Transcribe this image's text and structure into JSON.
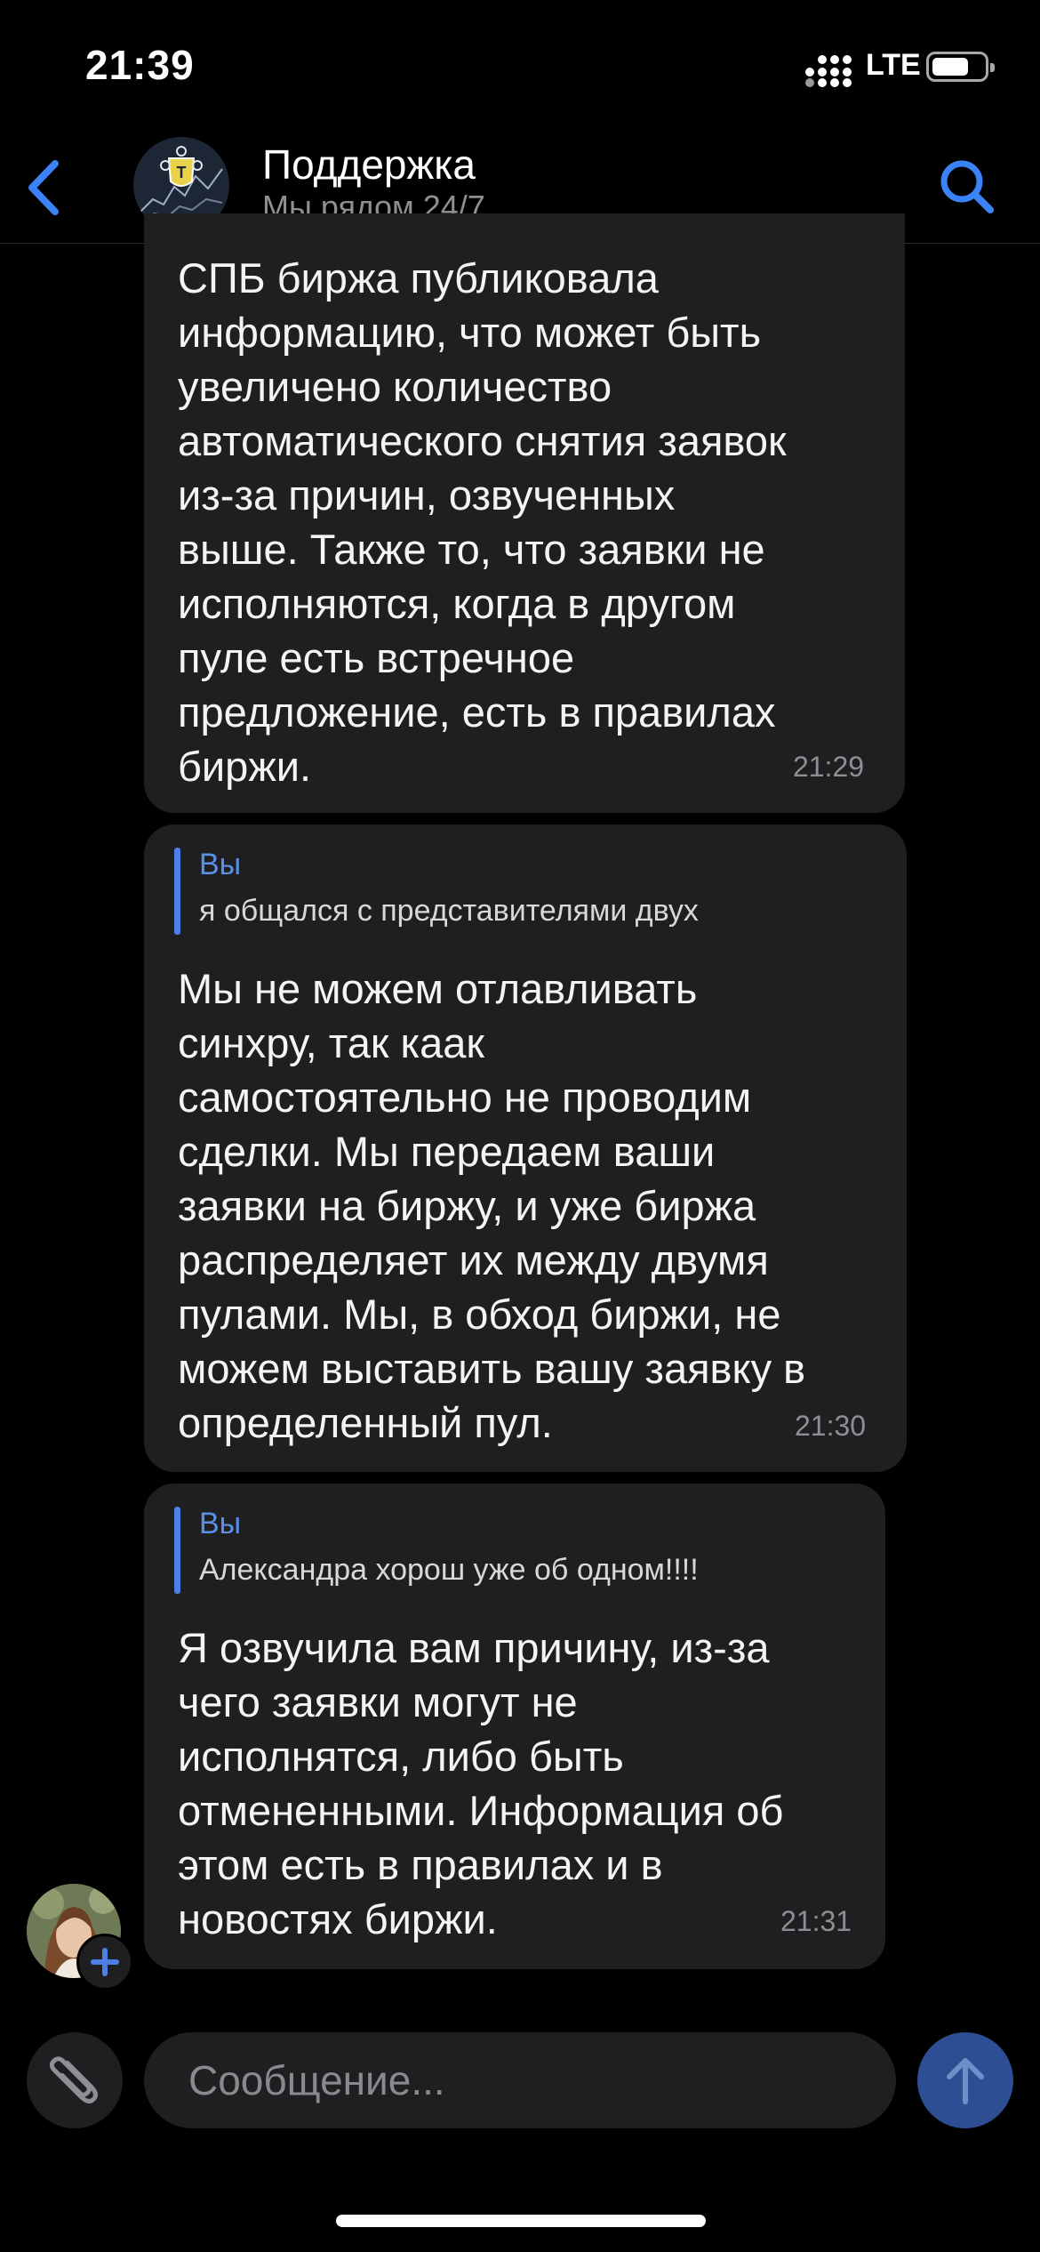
{
  "status_bar": {
    "time": "21:39",
    "network": "LTE"
  },
  "header": {
    "title": "Поддержка",
    "subtitle": "Мы рядом 24/7",
    "back_icon": "chevron-left-icon",
    "search_icon": "search-icon",
    "accent_color": "#3b82f6"
  },
  "messages": [
    {
      "text": "СПБ биржа публиковала\nинформацию, что может быть\nувеличено количество\nавтоматического снятия заявок\nиз-за причин, озвученных\nвыше. Также то, что заявки не\nисполняются, когда в другом\nпуле есть встречное\nпредложение, есть в правилах\nбиржи.",
      "time": "21:29"
    },
    {
      "reply_author": "Вы",
      "reply_text": "я общался с представителями двух",
      "text": "Мы не можем отлавливать\nсинхру, так каак\nсамостоятельно не проводим\nсделки. Мы передаем ваши\nзаявки на биржу, и уже биржа\nраспределяет их между двумя\nпулами. Мы, в обход биржи, не\nможем выставить вашу заявку в\nопределенный пул.",
      "time": "21:30"
    },
    {
      "reply_author": "Вы",
      "reply_text": "Александра хорош уже об одном!!!!",
      "text": "Я озвучила вам причину, из-за\nчего заявки могут не\nисполнятся, либо быть\nотмененными. Информация об\nэтом есть в правилах и в\nновостях биржи.",
      "time": "21:31"
    }
  ],
  "composer": {
    "placeholder": "Сообщение...",
    "attach_icon": "paperclip-icon",
    "send_icon": "arrow-up-icon"
  }
}
